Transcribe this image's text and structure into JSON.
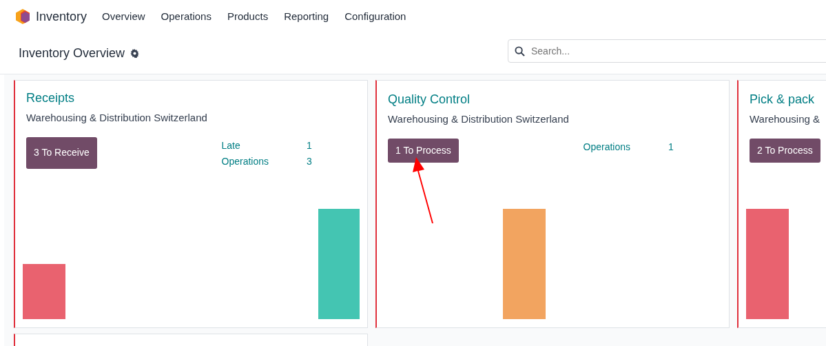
{
  "app": {
    "name": "Inventory"
  },
  "menu": [
    "Overview",
    "Operations",
    "Products",
    "Reporting",
    "Configuration"
  ],
  "page": {
    "title": "Inventory Overview"
  },
  "search": {
    "placeholder": "Search..."
  },
  "cards": [
    {
      "title": "Receipts",
      "subtitle": "Warehousing & Distribution Switzerland",
      "button": "3 To Receive",
      "stats": [
        {
          "label": "Late",
          "value": "1"
        },
        {
          "label": "Operations",
          "value": "3"
        }
      ]
    },
    {
      "title": "Quality Control",
      "subtitle": "Warehousing & Distribution Switzerland",
      "button": "1 To Process",
      "stats": [
        {
          "label": "Operations",
          "value": "1"
        }
      ]
    },
    {
      "title": "Pick & pack",
      "subtitle": "Warehousing &",
      "button": "2 To Process"
    }
  ]
}
